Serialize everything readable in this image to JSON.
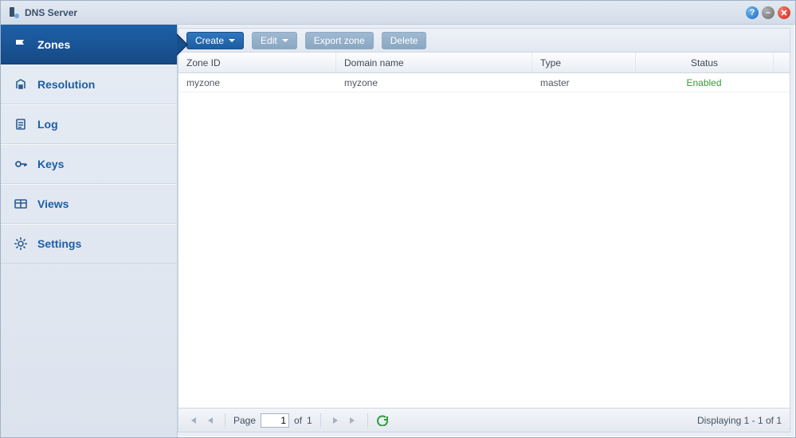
{
  "app": {
    "title": "DNS Server"
  },
  "sidebar": {
    "items": [
      {
        "label": "Zones",
        "icon": "flag-icon",
        "active": true
      },
      {
        "label": "Resolution",
        "icon": "resolution-icon"
      },
      {
        "label": "Log",
        "icon": "clipboard-icon"
      },
      {
        "label": "Keys",
        "icon": "key-icon"
      },
      {
        "label": "Views",
        "icon": "views-icon"
      },
      {
        "label": "Settings",
        "icon": "gear-icon"
      }
    ]
  },
  "toolbar": {
    "create_label": "Create",
    "edit_label": "Edit",
    "export_label": "Export zone",
    "delete_label": "Delete"
  },
  "table": {
    "headers": {
      "zone_id": "Zone ID",
      "domain": "Domain name",
      "type": "Type",
      "status": "Status"
    },
    "rows": [
      {
        "zone_id": "myzone",
        "domain": "myzone",
        "type": "master",
        "status": "Enabled"
      }
    ]
  },
  "pager": {
    "page_label": "Page",
    "current": "1",
    "of_label": "of",
    "total": "1",
    "summary": "Displaying 1 - 1 of 1"
  }
}
